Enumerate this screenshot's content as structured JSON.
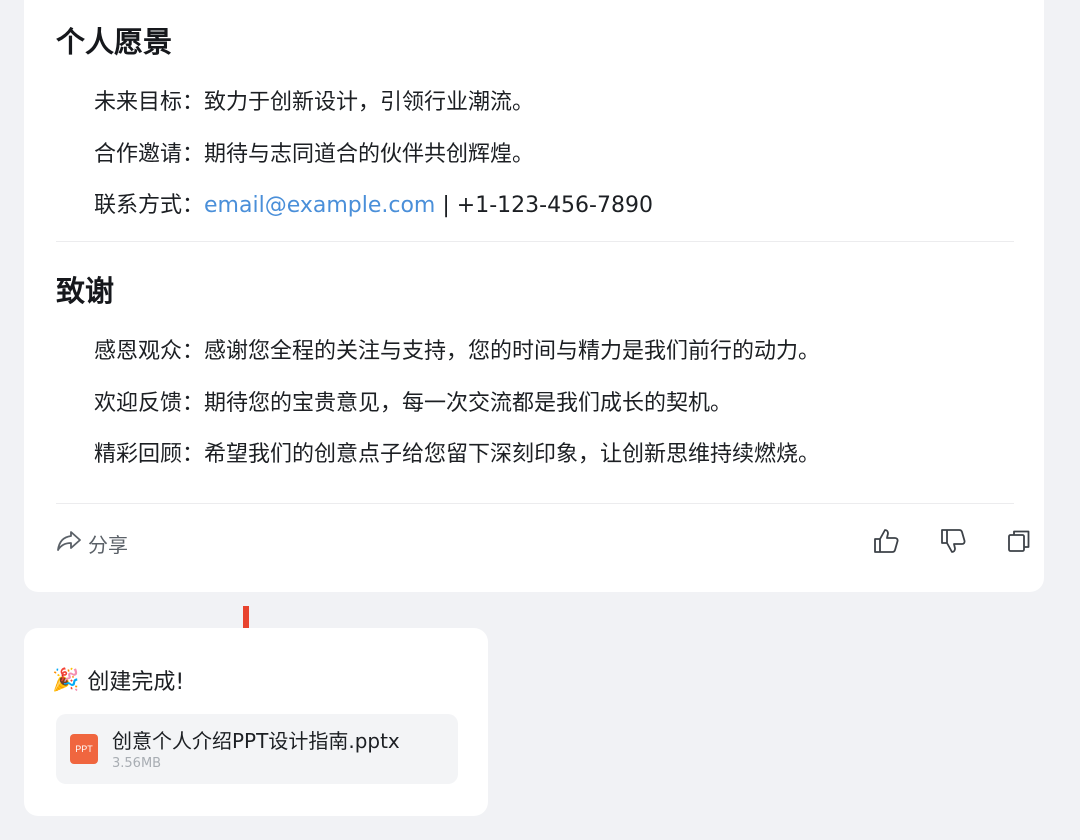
{
  "vision": {
    "title": "个人愿景",
    "items": [
      {
        "label": "未来目标：",
        "text": "致力于创新设计，引领行业潮流。"
      },
      {
        "label": "合作邀请：",
        "text": "期待与志同道合的伙伴共创辉煌。"
      }
    ],
    "contact": {
      "label": "联系方式：",
      "email": "email@example.com",
      "separator": " | ",
      "phone": "+1-123-456-7890"
    }
  },
  "thanks": {
    "title": "致谢",
    "items": [
      {
        "label": "感恩观众：",
        "text": "感谢您全程的关注与支持，您的时间与精力是我们前行的动力。"
      },
      {
        "label": "欢迎反馈：",
        "text": "期待您的宝贵意见，每一次交流都是我们成长的契机。"
      },
      {
        "label": "精彩回顾：",
        "text": "希望我们的创意点子给您留下深刻印象，让创新思维持续燃烧。"
      }
    ]
  },
  "actions": {
    "share_label": "分享",
    "icons": [
      "share-icon",
      "thumbs-up-icon",
      "thumbs-down-icon",
      "copy-icon"
    ]
  },
  "result": {
    "message": "创建完成!",
    "emoji": "🎉",
    "file": {
      "name": "创意个人介绍PPT设计指南.pptx",
      "size": "3.56MB",
      "badge": "PPT"
    }
  },
  "colors": {
    "link": "#4a8fd9",
    "arrow": "#e8432e",
    "ppt_badge": "#f0663f"
  }
}
